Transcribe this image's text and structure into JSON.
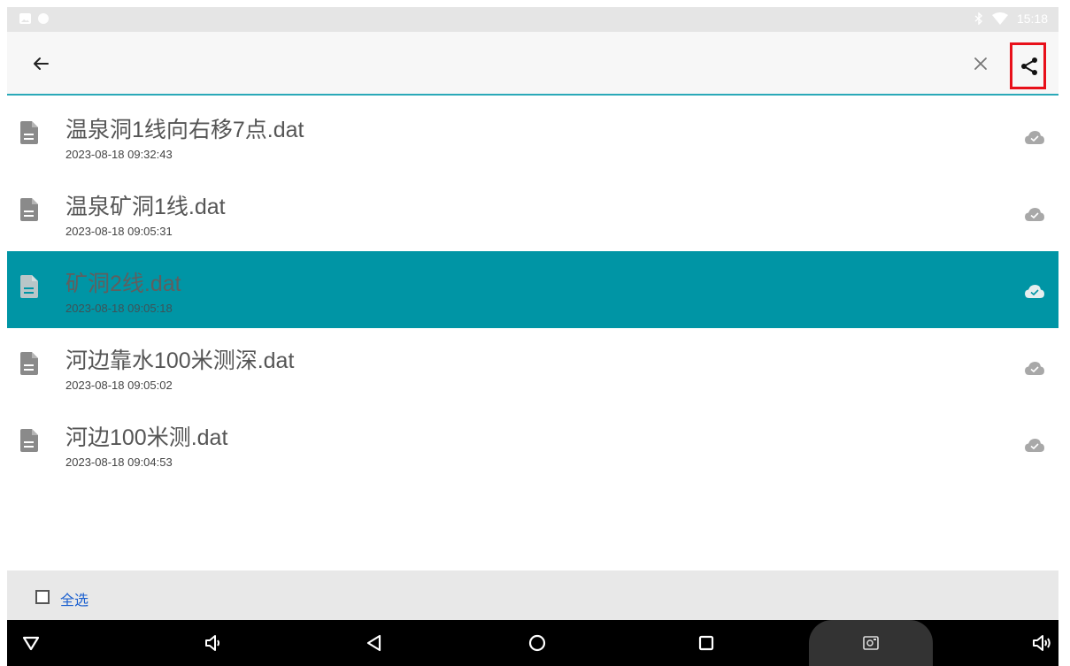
{
  "status_bar": {
    "time": "15:18",
    "icons": [
      "gallery-icon",
      "notification-dot-icon",
      "bluetooth-icon",
      "wifi-icon"
    ]
  },
  "toolbar": {
    "back_icon": "back-arrow-icon",
    "close_icon": "close-icon",
    "share_icon": "share-icon",
    "highlight_color": "#e8101a",
    "underline_color": "#2aa9b8"
  },
  "files": [
    {
      "name": "温泉洞1线向右移7点.dat",
      "time": "2023-08-18 09:32:43",
      "selected": false
    },
    {
      "name": "温泉矿洞1线.dat",
      "time": "2023-08-18 09:05:31",
      "selected": false
    },
    {
      "name": "矿洞2线.dat",
      "time": "2023-08-18 09:05:18",
      "selected": true
    },
    {
      "name": "河边靠水100米测深.dat",
      "time": "2023-08-18 09:05:02",
      "selected": false
    },
    {
      "name": "河边100米测.dat",
      "time": "2023-08-18 09:04:53",
      "selected": false
    }
  ],
  "select_all": {
    "label": "全选",
    "checked": false
  },
  "colors": {
    "selected_row": "#0095a5",
    "link_blue": "#1a5fcf"
  },
  "nav_bar": {
    "icons": [
      "hide-nav-icon",
      "volume-down-icon",
      "back-icon",
      "home-icon",
      "recents-icon",
      "screenshot-icon",
      "volume-up-icon"
    ]
  }
}
